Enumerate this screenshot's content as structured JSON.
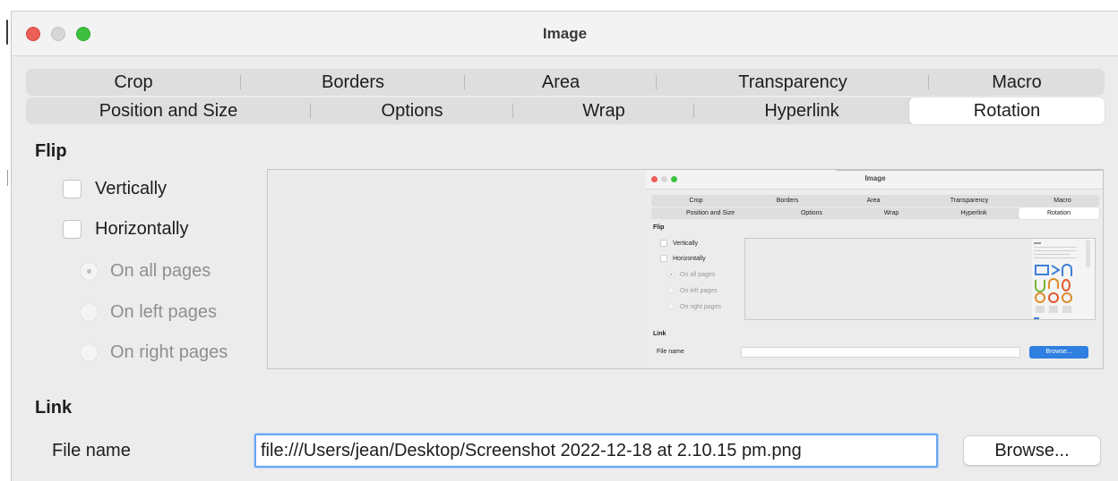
{
  "window": {
    "title": "Image"
  },
  "tabs": {
    "row1": [
      "Crop",
      "Borders",
      "Area",
      "Transparency",
      "Macro"
    ],
    "row2": [
      "Position and Size",
      "Options",
      "Wrap",
      "Hyperlink",
      "Rotation"
    ],
    "active": "Rotation"
  },
  "flip": {
    "title": "Flip",
    "vertically": {
      "label": "Vertically",
      "checked": false
    },
    "horizontally": {
      "label": "Horizontally",
      "checked": false
    },
    "pages": [
      {
        "label": "On all pages",
        "selected": true,
        "enabled": false
      },
      {
        "label": "On left pages",
        "selected": false,
        "enabled": false
      },
      {
        "label": "On right pages",
        "selected": false,
        "enabled": false
      }
    ]
  },
  "link": {
    "title": "Link",
    "file_name_label": "File name",
    "file_name_value": "file:///Users/jean/Desktop/Screenshot 2022-12-18 at 2.10.15 pm.png",
    "browse_label": "Browse..."
  },
  "preview_thumbnail": {
    "title": "Image",
    "row1": [
      "Crop",
      "Borders",
      "Area",
      "Transparency",
      "Macro"
    ],
    "row2": [
      "Position and Size",
      "Options",
      "Wrap",
      "Hyperlink",
      "Rotation"
    ],
    "flip_title": "Flip",
    "vertically": "Vertically",
    "horizontally": "Horizontally",
    "pages": [
      "On all pages",
      "On left pages",
      "On right pages"
    ],
    "link_title": "Link",
    "file_name_label": "File name",
    "browse_label": "Browse..."
  },
  "colors": {
    "close": "#ec5f56",
    "minimize": "#d6d6d6",
    "maximize": "#3ec03f",
    "focus_ring": "#6aa6ee",
    "mini_browse": "#2f7fe0"
  }
}
